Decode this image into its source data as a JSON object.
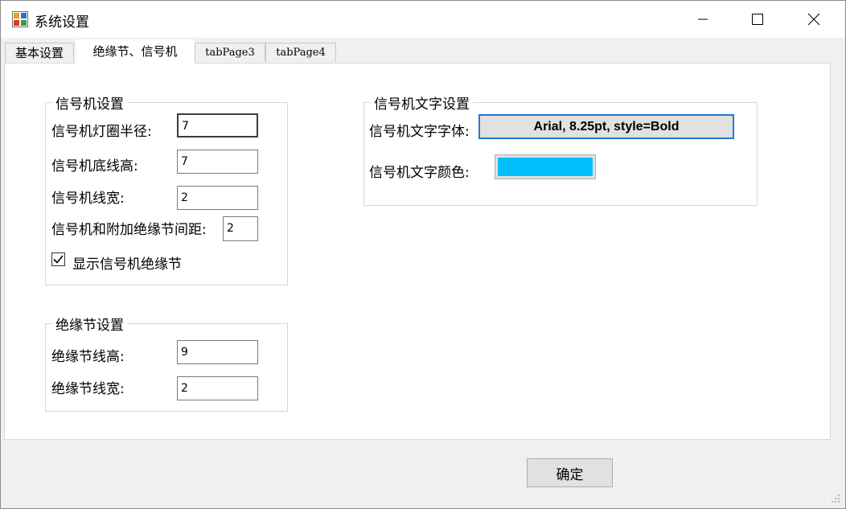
{
  "window": {
    "title": "系统设置"
  },
  "tabs": [
    {
      "label": "基本设置"
    },
    {
      "label": "绝缘节、信号机"
    },
    {
      "label": "tabPage3"
    },
    {
      "label": "tabPage4"
    }
  ],
  "signal_group": {
    "title": "信号机设置",
    "lamp_radius_label": "信号机灯圈半径:",
    "lamp_radius_value": "7",
    "base_height_label": "信号机底线高:",
    "base_height_value": "7",
    "line_width_label": "信号机线宽:",
    "line_width_value": "2",
    "gap_label": "信号机和附加绝缘节间距:",
    "gap_value": "2",
    "show_joint_label": "显示信号机绝缘节",
    "show_joint_checked": true
  },
  "joint_group": {
    "title": "绝缘节设置",
    "line_height_label": "绝缘节线高:",
    "line_height_value": "9",
    "line_width_label": "绝缘节线宽:",
    "line_width_value": "2"
  },
  "text_group": {
    "title": "信号机文字设置",
    "font_label": "信号机文字字体:",
    "font_value": "Arial, 8.25pt, style=Bold",
    "color_label": "信号机文字颜色:",
    "color_value": "#00bfff"
  },
  "footer": {
    "ok_label": "确定"
  },
  "icons": [
    "app-icon",
    "minimize-icon",
    "maximize-icon",
    "close-icon",
    "check-icon",
    "resize-grip-icon"
  ]
}
